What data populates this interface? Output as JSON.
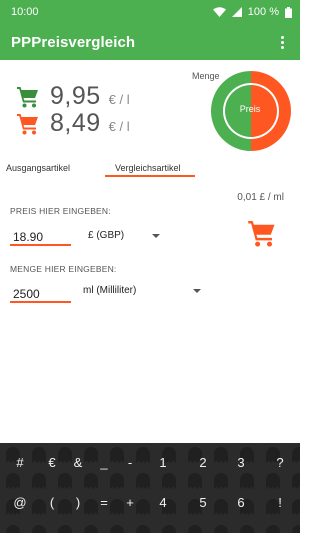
{
  "status_bar": {
    "time": "10:00",
    "battery": "100 %"
  },
  "app_bar": {
    "title": "PPPreisvergleich"
  },
  "comparison": {
    "price_1": "9,95",
    "unit_1": "€ / l",
    "price_2": "8,49",
    "unit_2": "€ / l",
    "menge_label": "Menge",
    "preis_label": "Preis"
  },
  "tabs": {
    "tab_1": "Ausgangsartikel",
    "tab_2": "Vergleichsartikel"
  },
  "rate": "0,01 £ / ml",
  "price_field": {
    "label": "PREIS HIER EINGEBEN:",
    "value": "18.90",
    "currency": "£ (GBP)"
  },
  "quantity_field": {
    "label": "MENGE HIER EINGEBEN:",
    "value": "2500",
    "unit": "ml (Milliliter)"
  },
  "keyboard": {
    "row1": [
      "#",
      "€",
      "&",
      "_",
      "-",
      "1",
      "2",
      "3",
      "?"
    ],
    "row2": [
      "@",
      "(",
      ")",
      "=",
      "+",
      "4",
      "5",
      "6",
      "!"
    ]
  },
  "colors": {
    "primary_green": "#4caf50",
    "accent_orange": "#ff5722",
    "keyboard_bg": "#2b2b2b"
  }
}
